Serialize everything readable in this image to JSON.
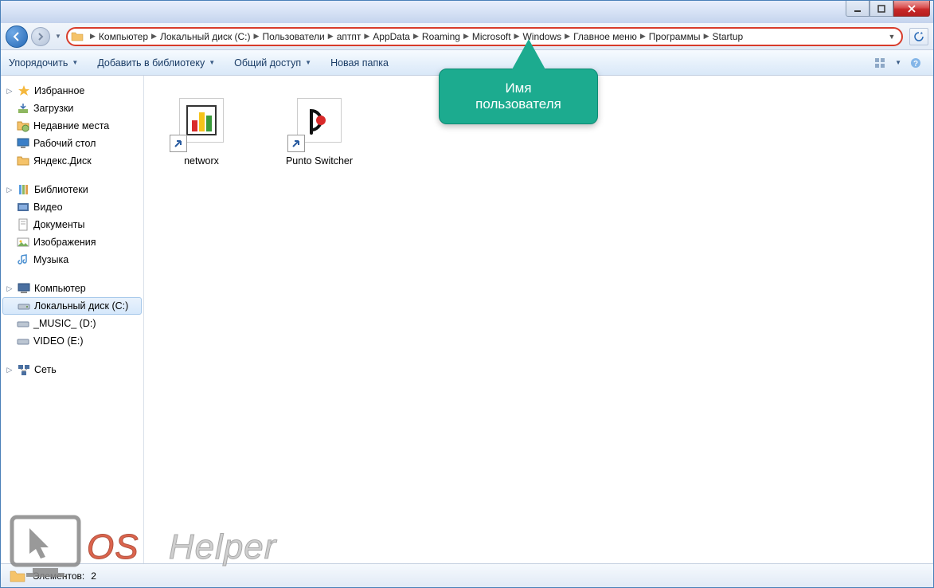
{
  "window_controls": {
    "minimize": "minimize",
    "maximize": "maximize",
    "close": "close"
  },
  "breadcrumbs": [
    "Компьютер",
    "Локальный диск (C:)",
    "Пользователи",
    "аптпт",
    "AppData",
    "Roaming",
    "Microsoft",
    "Windows",
    "Главное меню",
    "Программы",
    "Startup"
  ],
  "toolbar": {
    "organize": "Упорядочить",
    "add_library": "Добавить в библиотеку",
    "share": "Общий доступ",
    "new_folder": "Новая папка"
  },
  "sidebar": {
    "favorites": {
      "label": "Избранное",
      "items": [
        "Загрузки",
        "Недавние места",
        "Рабочий стол",
        "Яндекс.Диск"
      ]
    },
    "libraries": {
      "label": "Библиотеки",
      "items": [
        "Видео",
        "Документы",
        "Изображения",
        "Музыка"
      ]
    },
    "computer": {
      "label": "Компьютер",
      "items": [
        "Локальный диск (C:)",
        "_MUSIC_ (D:)",
        "VIDEO (E:)"
      ]
    },
    "network": {
      "label": "Сеть"
    }
  },
  "files": [
    {
      "name": "networx",
      "icon": "networx"
    },
    {
      "name": "Punto Switcher",
      "icon": "punto"
    }
  ],
  "callout": {
    "line1": "Имя",
    "line2": "пользователя"
  },
  "statusbar": {
    "elements_label": "Элементов:",
    "count": "2"
  },
  "watermark": {
    "os": "OS",
    "helper": "Helper"
  }
}
